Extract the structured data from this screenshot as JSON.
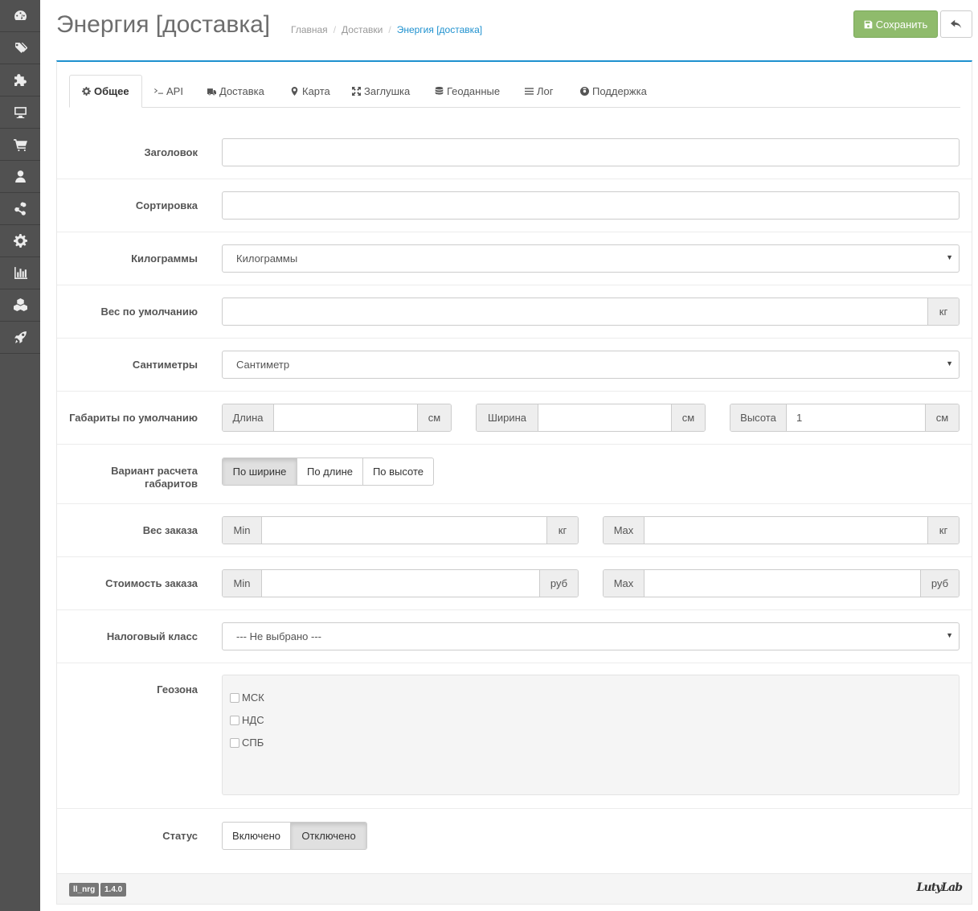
{
  "header": {
    "title": "Энергия [доставка]",
    "breadcrumb": [
      "Главная",
      "Доставки",
      "Энергия [доставка]"
    ],
    "save_label": "Сохранить"
  },
  "sidebar": {
    "icons": [
      "dashboard-icon",
      "tags-icon",
      "puzzle-icon",
      "desktop-icon",
      "cart-icon",
      "user-icon",
      "share-icon",
      "gear-icon",
      "chart-icon",
      "cubes-icon",
      "rocket-icon"
    ]
  },
  "tabs": [
    {
      "label": "Общее",
      "icon": "gear-icon",
      "active": true
    },
    {
      "label": "API",
      "icon": "terminal-icon",
      "active": false
    },
    {
      "label": "Доставка",
      "icon": "truck-icon",
      "active": false
    },
    {
      "label": "Карта",
      "icon": "map-marker-icon",
      "active": false
    },
    {
      "label": "Заглушка",
      "icon": "arrows-icon",
      "active": false
    },
    {
      "label": "Геоданные",
      "icon": "database-icon",
      "active": false
    },
    {
      "label": "Лог",
      "icon": "list-icon",
      "active": false
    },
    {
      "label": "Поддержка",
      "icon": "lifebuoy-icon",
      "active": false
    }
  ],
  "form": {
    "title_label": "Заголовок",
    "title_value": "",
    "sort_label": "Сортировка",
    "sort_value": "",
    "weight_unit_label": "Килограммы",
    "weight_unit_value": "Килограммы",
    "default_weight_label": "Вес по умолчанию",
    "default_weight_value": "",
    "default_weight_unit": "кг",
    "length_unit_label": "Сантиметры",
    "length_unit_value": "Сантиметр",
    "dims_label": "Габариты по умолчанию",
    "dims": {
      "length_label": "Длина",
      "length_value": "",
      "length_unit": "см",
      "width_label": "Ширина",
      "width_value": "",
      "width_unit": "см",
      "height_label": "Высота",
      "height_value": "1",
      "height_unit": "см"
    },
    "calc_label_1": "Вариант расчета",
    "calc_label_2": "габаритов",
    "calc_options": [
      "По ширине",
      "По длине",
      "По высоте"
    ],
    "calc_selected": "По ширине",
    "order_weight_label": "Вес заказа",
    "order_weight": {
      "min_label": "Min",
      "min_value": "",
      "max_label": "Max",
      "max_value": "",
      "unit": "кг"
    },
    "order_cost_label": "Стоимость заказа",
    "order_cost": {
      "min_label": "Min",
      "min_value": "",
      "max_label": "Max",
      "max_value": "",
      "unit": "руб"
    },
    "tax_label": "Налоговый класс",
    "tax_value": "--- Не выбрано ---",
    "geo_label": "Геозона",
    "geo_zones": [
      "МСК",
      "НДС",
      "СПБ"
    ],
    "status_label": "Статус",
    "status_options": [
      "Включено",
      "Отключено"
    ],
    "status_selected": "Отключено"
  },
  "footer": {
    "module_code": "ll_nrg",
    "version": "1.4.0",
    "brand": "LutyLab"
  }
}
